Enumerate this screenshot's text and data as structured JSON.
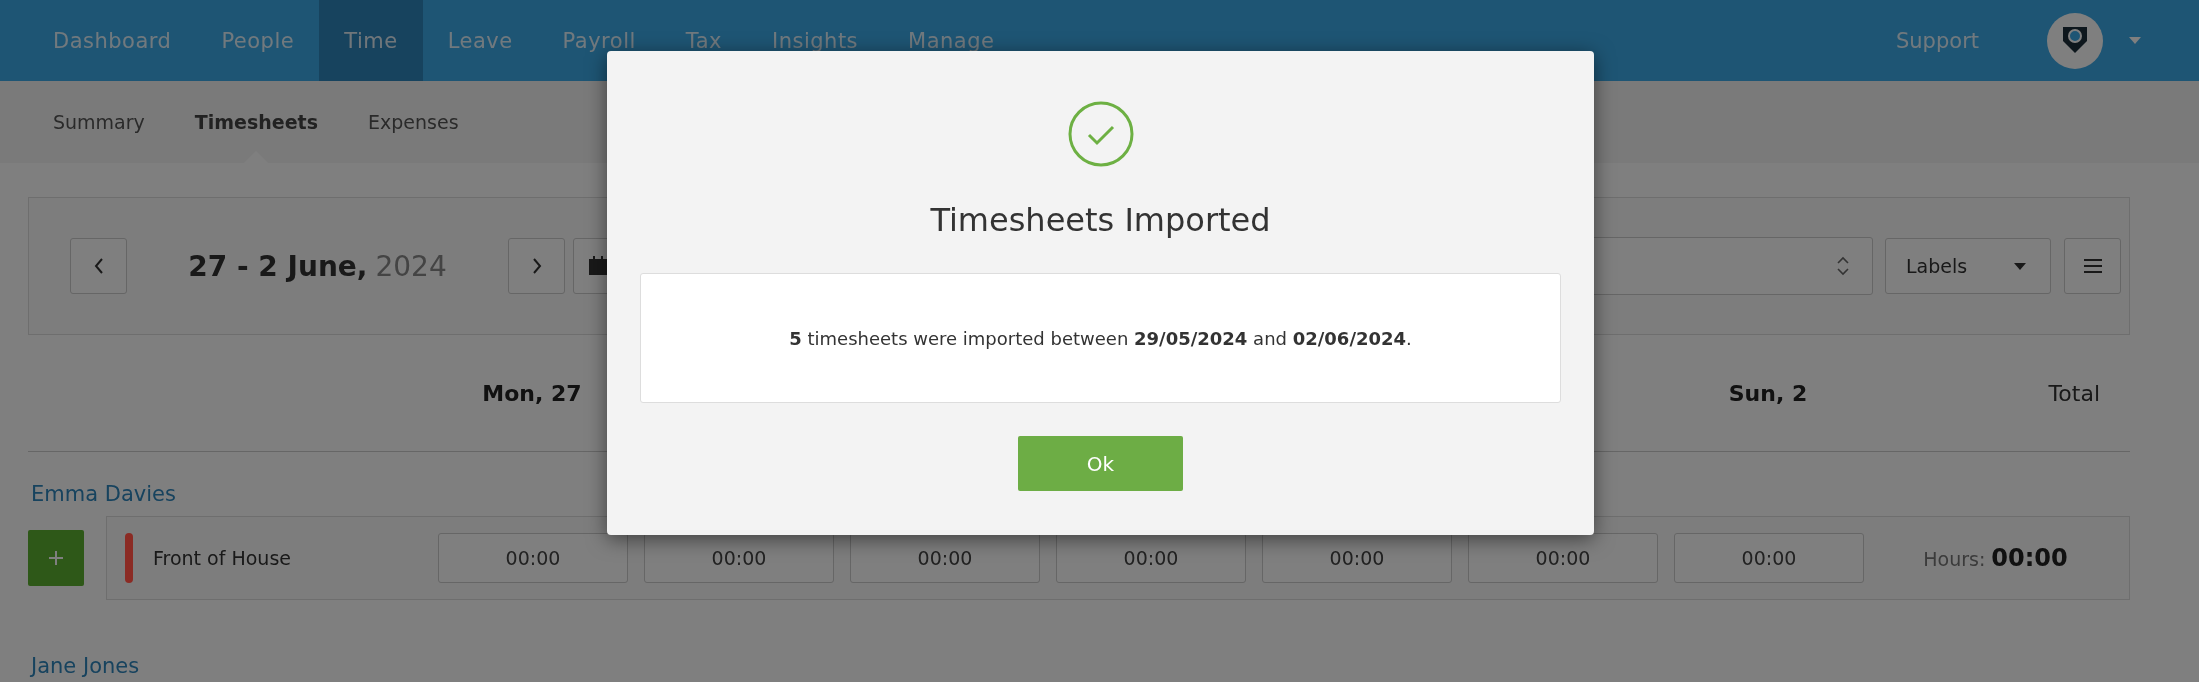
{
  "nav": {
    "items": [
      {
        "label": "Dashboard",
        "selected": false
      },
      {
        "label": "People",
        "selected": false
      },
      {
        "label": "Time",
        "selected": true
      },
      {
        "label": "Leave",
        "selected": false
      },
      {
        "label": "Payroll",
        "selected": false
      },
      {
        "label": "Tax",
        "selected": false
      },
      {
        "label": "Insights",
        "selected": false
      },
      {
        "label": "Manage",
        "selected": false
      }
    ],
    "support": "Support"
  },
  "subnav": [
    {
      "label": "Summary",
      "selected": false
    },
    {
      "label": "Timesheets",
      "selected": true
    },
    {
      "label": "Expenses",
      "selected": false
    }
  ],
  "toolbar": {
    "date": "27 - 2 June,",
    "year": "2024",
    "labels_dropdown": "Labels"
  },
  "week_header": {
    "first_day": "Mon, 27",
    "last_day": "Sun, 2",
    "total": "Total"
  },
  "employees": [
    {
      "name": "Emma Davies",
      "rows": [
        {
          "label": "Front of House",
          "color": "#8b2b24",
          "times": [
            "00:00",
            "00:00",
            "00:00",
            "00:00",
            "00:00",
            "00:00",
            "00:00"
          ],
          "hours_label": "Hours:",
          "hours": "00:00"
        }
      ]
    },
    {
      "name": "Jane Jones"
    }
  ],
  "modal": {
    "title": "Timesheets Imported",
    "message": "**5** timesheets were imported between **29/05/2024** and **02/06/2024**.",
    "button": "Ok"
  }
}
